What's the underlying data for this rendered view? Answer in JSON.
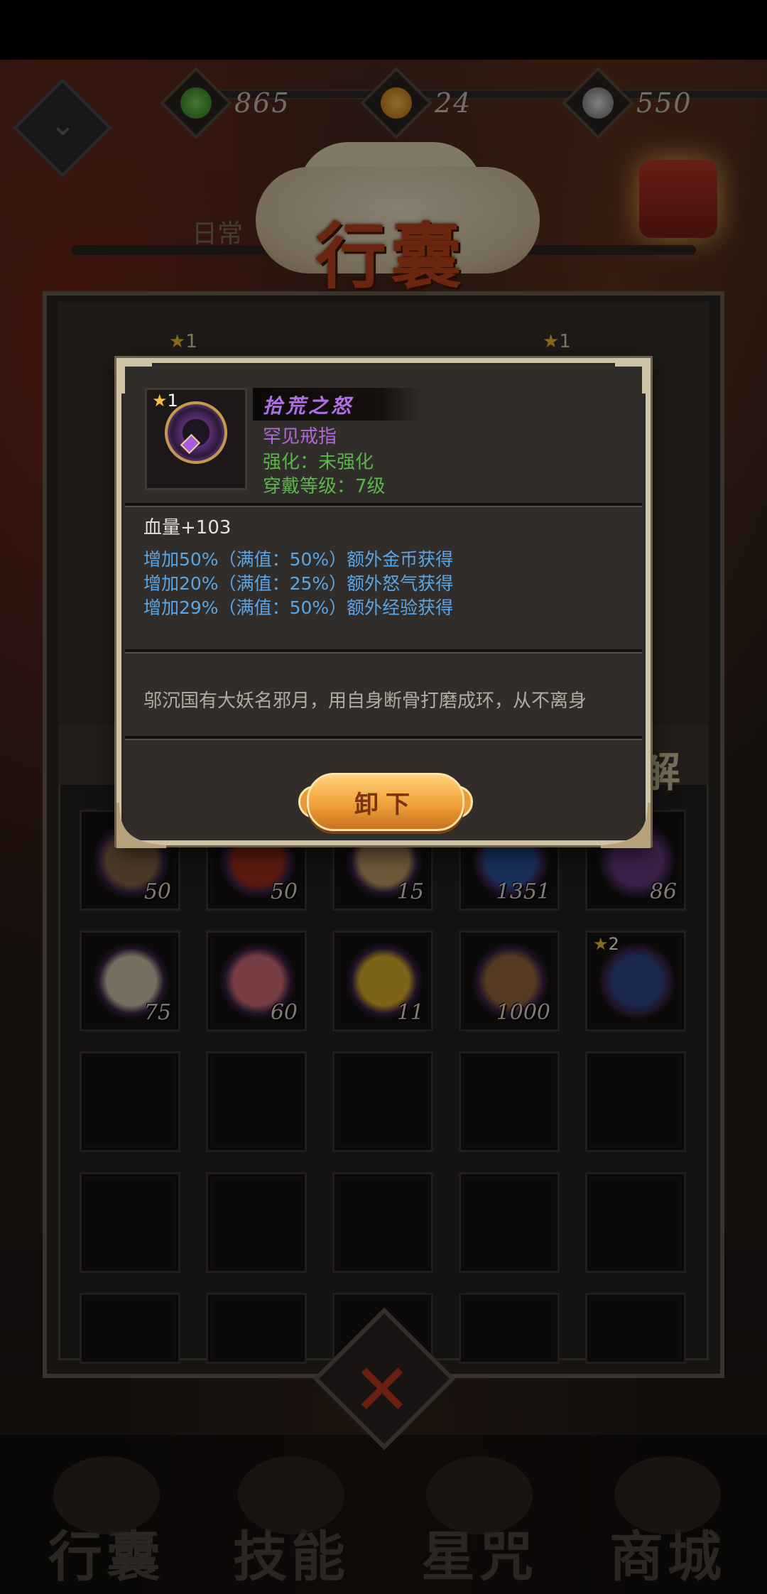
{
  "resources": [
    {
      "icon": "jade-icon",
      "value": "865",
      "color": "#3aa035"
    },
    {
      "icon": "coin-icon",
      "value": "24",
      "color": "#e79b2a"
    },
    {
      "icon": "silver-icon",
      "value": "550",
      "color": "#b9b9b9"
    }
  ],
  "header": {
    "title": "行囊",
    "daily_tab": "日常"
  },
  "equipment": {
    "left_star": "1",
    "right_star": "1",
    "decompose_label": "解"
  },
  "popup": {
    "star": "1",
    "item_name": "拾荒之怒",
    "item_type": "罕见戒指",
    "enhance": "强化：未强化",
    "wear_level": "穿戴等级：7级",
    "stat_main": "血量+103",
    "bonuses": [
      "增加50%（满值：50%）额外金币获得",
      "增加20%（满值：25%）额外怒气获得",
      "增加29%（满值：50%）额外经验获得"
    ],
    "description": "邬沉国有大妖名邪月，用自身断骨打磨成环，从不离身",
    "unequip_label": "卸下"
  },
  "inventory": [
    {
      "icon": "rice-bowl-icon",
      "qty": "50",
      "color": "#8a6a4a"
    },
    {
      "icon": "chili-icon",
      "qty": "50",
      "color": "#a8321e"
    },
    {
      "icon": "scroll-icon",
      "qty": "15",
      "color": "#c9a36a"
    },
    {
      "icon": "blue-crystal-icon",
      "qty": "1351",
      "color": "#2e5aa8"
    },
    {
      "icon": "fish-icon",
      "qty": "86",
      "color": "#6a3e86"
    },
    {
      "icon": "flour-sack-icon",
      "qty": "75",
      "color": "#d8cbb0"
    },
    {
      "icon": "peach-icon",
      "qty": "60",
      "color": "#d8707a"
    },
    {
      "icon": "talisman-icon",
      "qty": "11",
      "color": "#e2b42a"
    },
    {
      "icon": "bucket-icon",
      "qty": "1000",
      "color": "#9a6a3a"
    },
    {
      "icon": "blue-bracelet-icon",
      "qty": "",
      "star": "2",
      "color": "#2f4a8a"
    }
  ],
  "nav": [
    {
      "label": "行囊",
      "icon": "bag-icon"
    },
    {
      "label": "技能",
      "icon": "skill-icon"
    },
    {
      "label": "星咒",
      "icon": "star-curse-icon"
    },
    {
      "label": "商城",
      "icon": "shop-icon"
    }
  ]
}
